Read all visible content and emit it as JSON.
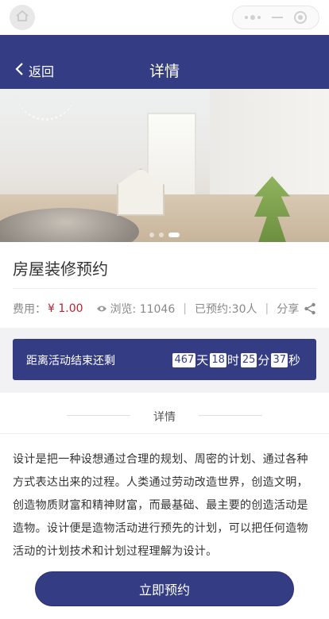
{
  "mini_program_bar": {
    "title": "详情",
    "home_icon": "home-icon",
    "more_icon": "more-dots-icon",
    "minimize_icon": "minimize-icon",
    "close_icon": "target-close-icon"
  },
  "nav": {
    "back_label": "返回",
    "title": "详情"
  },
  "banner": {
    "slides": 3,
    "active_slide": 3
  },
  "activity": {
    "name": "房屋装修预约",
    "fee_label": "费用：",
    "fee_value": "¥ 1.00",
    "views_label": "浏览: 11046",
    "booked_label": "已预约:30人",
    "share_label": "分享"
  },
  "countdown": {
    "label": "距离活动结束还剩",
    "days": "467",
    "days_unit": "天",
    "hours": "18",
    "hours_unit": "时",
    "minutes": "25",
    "minutes_unit": "分",
    "seconds": "37",
    "seconds_unit": "秒"
  },
  "detail": {
    "header": "详情",
    "text": "设计是把一种设想通过合理的规划、周密的计划、通过各种方式表达出来的过程。人类通过劳动改造世界，创造文明，创造物质财富和精神财富，而最基础、最主要的创造活动是造物。设计便是造物活动进行预先的计划，可以把任何造物活动的计划技术和计划过程理解为设计。"
  },
  "bottom": {
    "book_label": "立即预约"
  },
  "colors": {
    "primary": "#343c83",
    "price": "#c21f30"
  }
}
